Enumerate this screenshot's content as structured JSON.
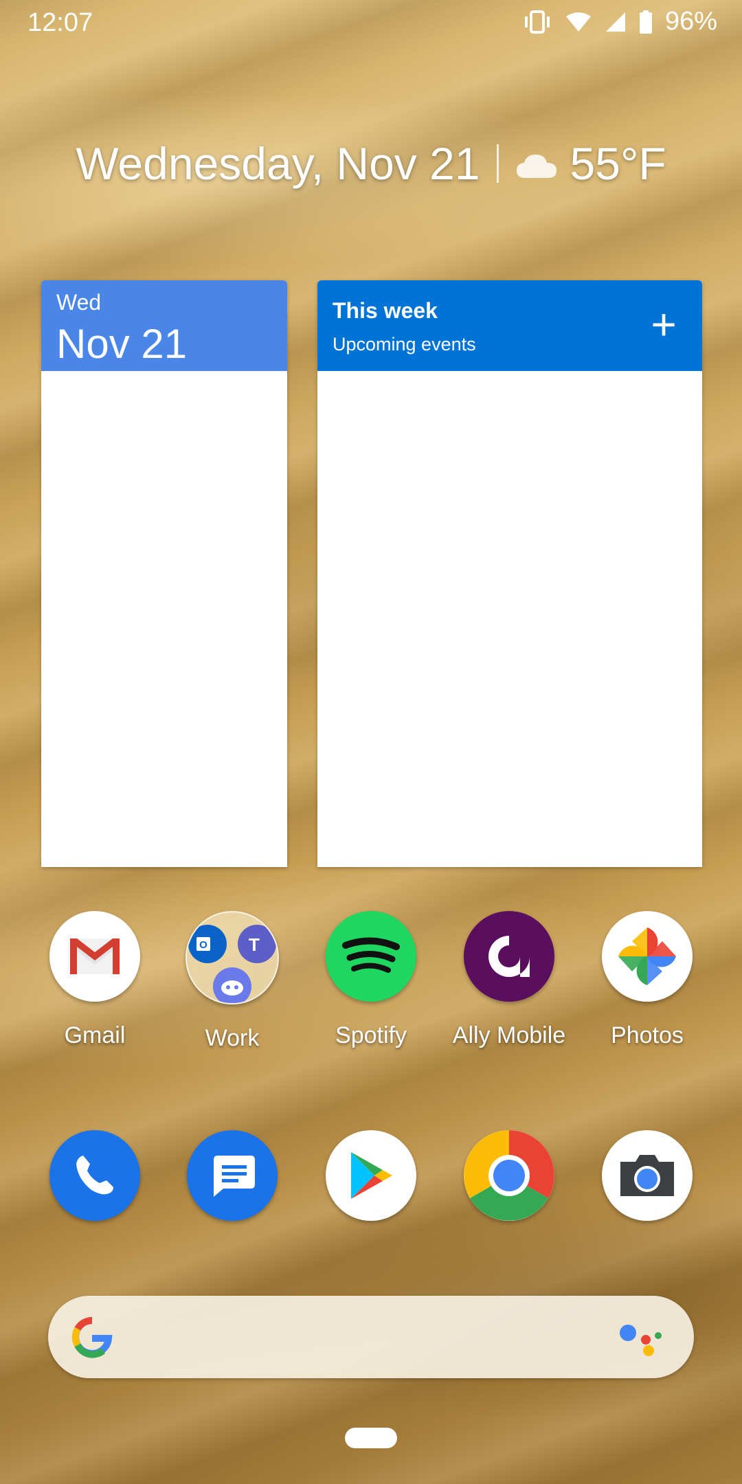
{
  "status_bar": {
    "time": "12:07",
    "battery": "96%"
  },
  "glance": {
    "date": "Wednesday, Nov 21",
    "temperature": "55°F"
  },
  "calendar_widget": {
    "day": "Wed",
    "date": "Nov 21"
  },
  "week_widget": {
    "title": "This week",
    "subtitle": "Upcoming events",
    "add_icon": "+"
  },
  "apps_row": [
    {
      "label": "Gmail",
      "icon": "gmail-icon"
    },
    {
      "label": "Work",
      "icon": "folder-icon"
    },
    {
      "label": "Spotify",
      "icon": "spotify-icon"
    },
    {
      "label": "Ally Mobile",
      "icon": "ally-icon"
    },
    {
      "label": "Photos",
      "icon": "photos-icon"
    }
  ],
  "dock": [
    {
      "icon": "phone-icon"
    },
    {
      "icon": "messages-icon"
    },
    {
      "icon": "play-store-icon"
    },
    {
      "icon": "chrome-icon"
    },
    {
      "icon": "camera-icon"
    }
  ],
  "colors": {
    "calendar_header": "#4a86e8",
    "week_header": "#0074d6",
    "spotify": "#1ed760",
    "ally": "#5a0f5e",
    "phone": "#1a73e8"
  }
}
